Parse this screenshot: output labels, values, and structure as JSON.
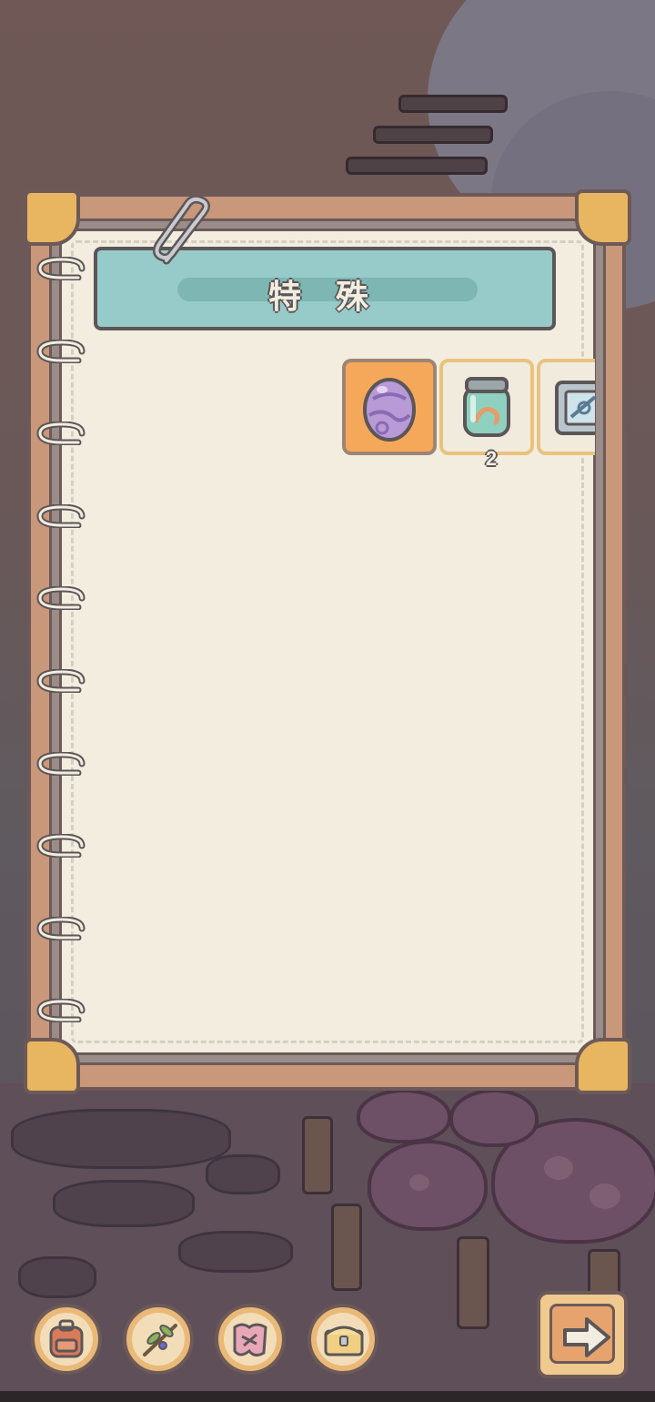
{
  "category": {
    "title": "特 殊"
  },
  "slots": [
    {
      "name": "purple-swirl-egg",
      "count": ""
    },
    {
      "name": "specimen-jar",
      "count": "2"
    },
    {
      "name": "blueprint-frame",
      "count": ""
    }
  ],
  "toolbar": {
    "items": [
      "backpack-icon",
      "branch-icon",
      "map-icon",
      "chest-icon"
    ],
    "next": "arrow-right-icon"
  },
  "colors": {
    "banner": "#97cbc9",
    "page": "#f3ede0",
    "selected_slot": "#f6a85a",
    "frame": "#c9977a"
  }
}
